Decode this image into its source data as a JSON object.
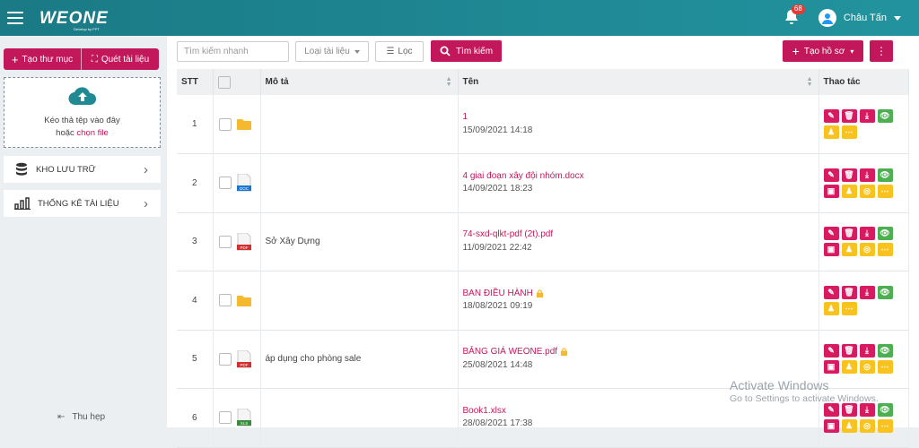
{
  "header": {
    "logo": "WEONE",
    "logo_sub": "Develop by FPT",
    "notif_count": "68",
    "user_name": "Châu Tấn"
  },
  "sidebar": {
    "create_folder": "Tạo thư mục",
    "scan_doc": "Quét tài liệu",
    "drop_line1": "Kéo thả tệp vào đây",
    "drop_line2_prefix": "hoặc ",
    "drop_line2_link": "chọn file",
    "items": [
      {
        "label": "KHO LƯU TRỮ",
        "icon": "database-icon"
      },
      {
        "label": "THỐNG KÊ TÀI LIỆU",
        "icon": "bar-chart-icon"
      }
    ],
    "collapse": "Thu hẹp"
  },
  "toolbar": {
    "search_placeholder": "Tìm kiếm nhanh",
    "doc_type": "Loại tài liệu",
    "filter": "Lọc",
    "find": "Tìm kiếm",
    "new_record": "Tạo hồ sơ",
    "more": "⋮"
  },
  "table": {
    "headers": {
      "stt": "STT",
      "desc": "Mô tả",
      "name": "Tên",
      "actions": "Thao tác"
    },
    "rows": [
      {
        "stt": "1",
        "type": "folder",
        "desc": "",
        "name": "1",
        "date": "15/09/2021 14:18",
        "locked": false,
        "buttons": 6
      },
      {
        "stt": "2",
        "type": "doc",
        "desc": "",
        "name": "4 giai đoạn xây đội nhóm.docx",
        "date": "14/09/2021 18:23",
        "locked": false,
        "buttons": 8
      },
      {
        "stt": "3",
        "type": "pdf",
        "desc": "Sở Xây Dựng",
        "name": "74-sxd-qlkt-pdf (2t).pdf",
        "date": "11/09/2021 22:42",
        "locked": false,
        "buttons": 8
      },
      {
        "stt": "4",
        "type": "folder",
        "desc": "",
        "name": "BAN ĐIỀU HÀNH",
        "date": "18/08/2021 09:19",
        "locked": true,
        "buttons": 6
      },
      {
        "stt": "5",
        "type": "pdf",
        "desc": "áp dụng cho phòng sale",
        "name": "BẢNG GIÁ WEONE.pdf",
        "date": "25/08/2021 14:48",
        "locked": true,
        "buttons": 8
      },
      {
        "stt": "6",
        "type": "xls",
        "desc": "",
        "name": "Book1.xlsx",
        "date": "28/08/2021 17:38",
        "locked": false,
        "buttons": 8
      }
    ],
    "file_labels": {
      "doc": "DOC",
      "pdf": "PDF",
      "xls": "XLS"
    }
  },
  "watermark": {
    "line1": "Activate Windows",
    "line2": "Go to Settings to activate Windows."
  },
  "colors": {
    "header": "#1f8a94",
    "accent": "#c2185b",
    "green": "#4caf50",
    "yellow": "#f9c31f",
    "folder": "#f5b82e"
  }
}
